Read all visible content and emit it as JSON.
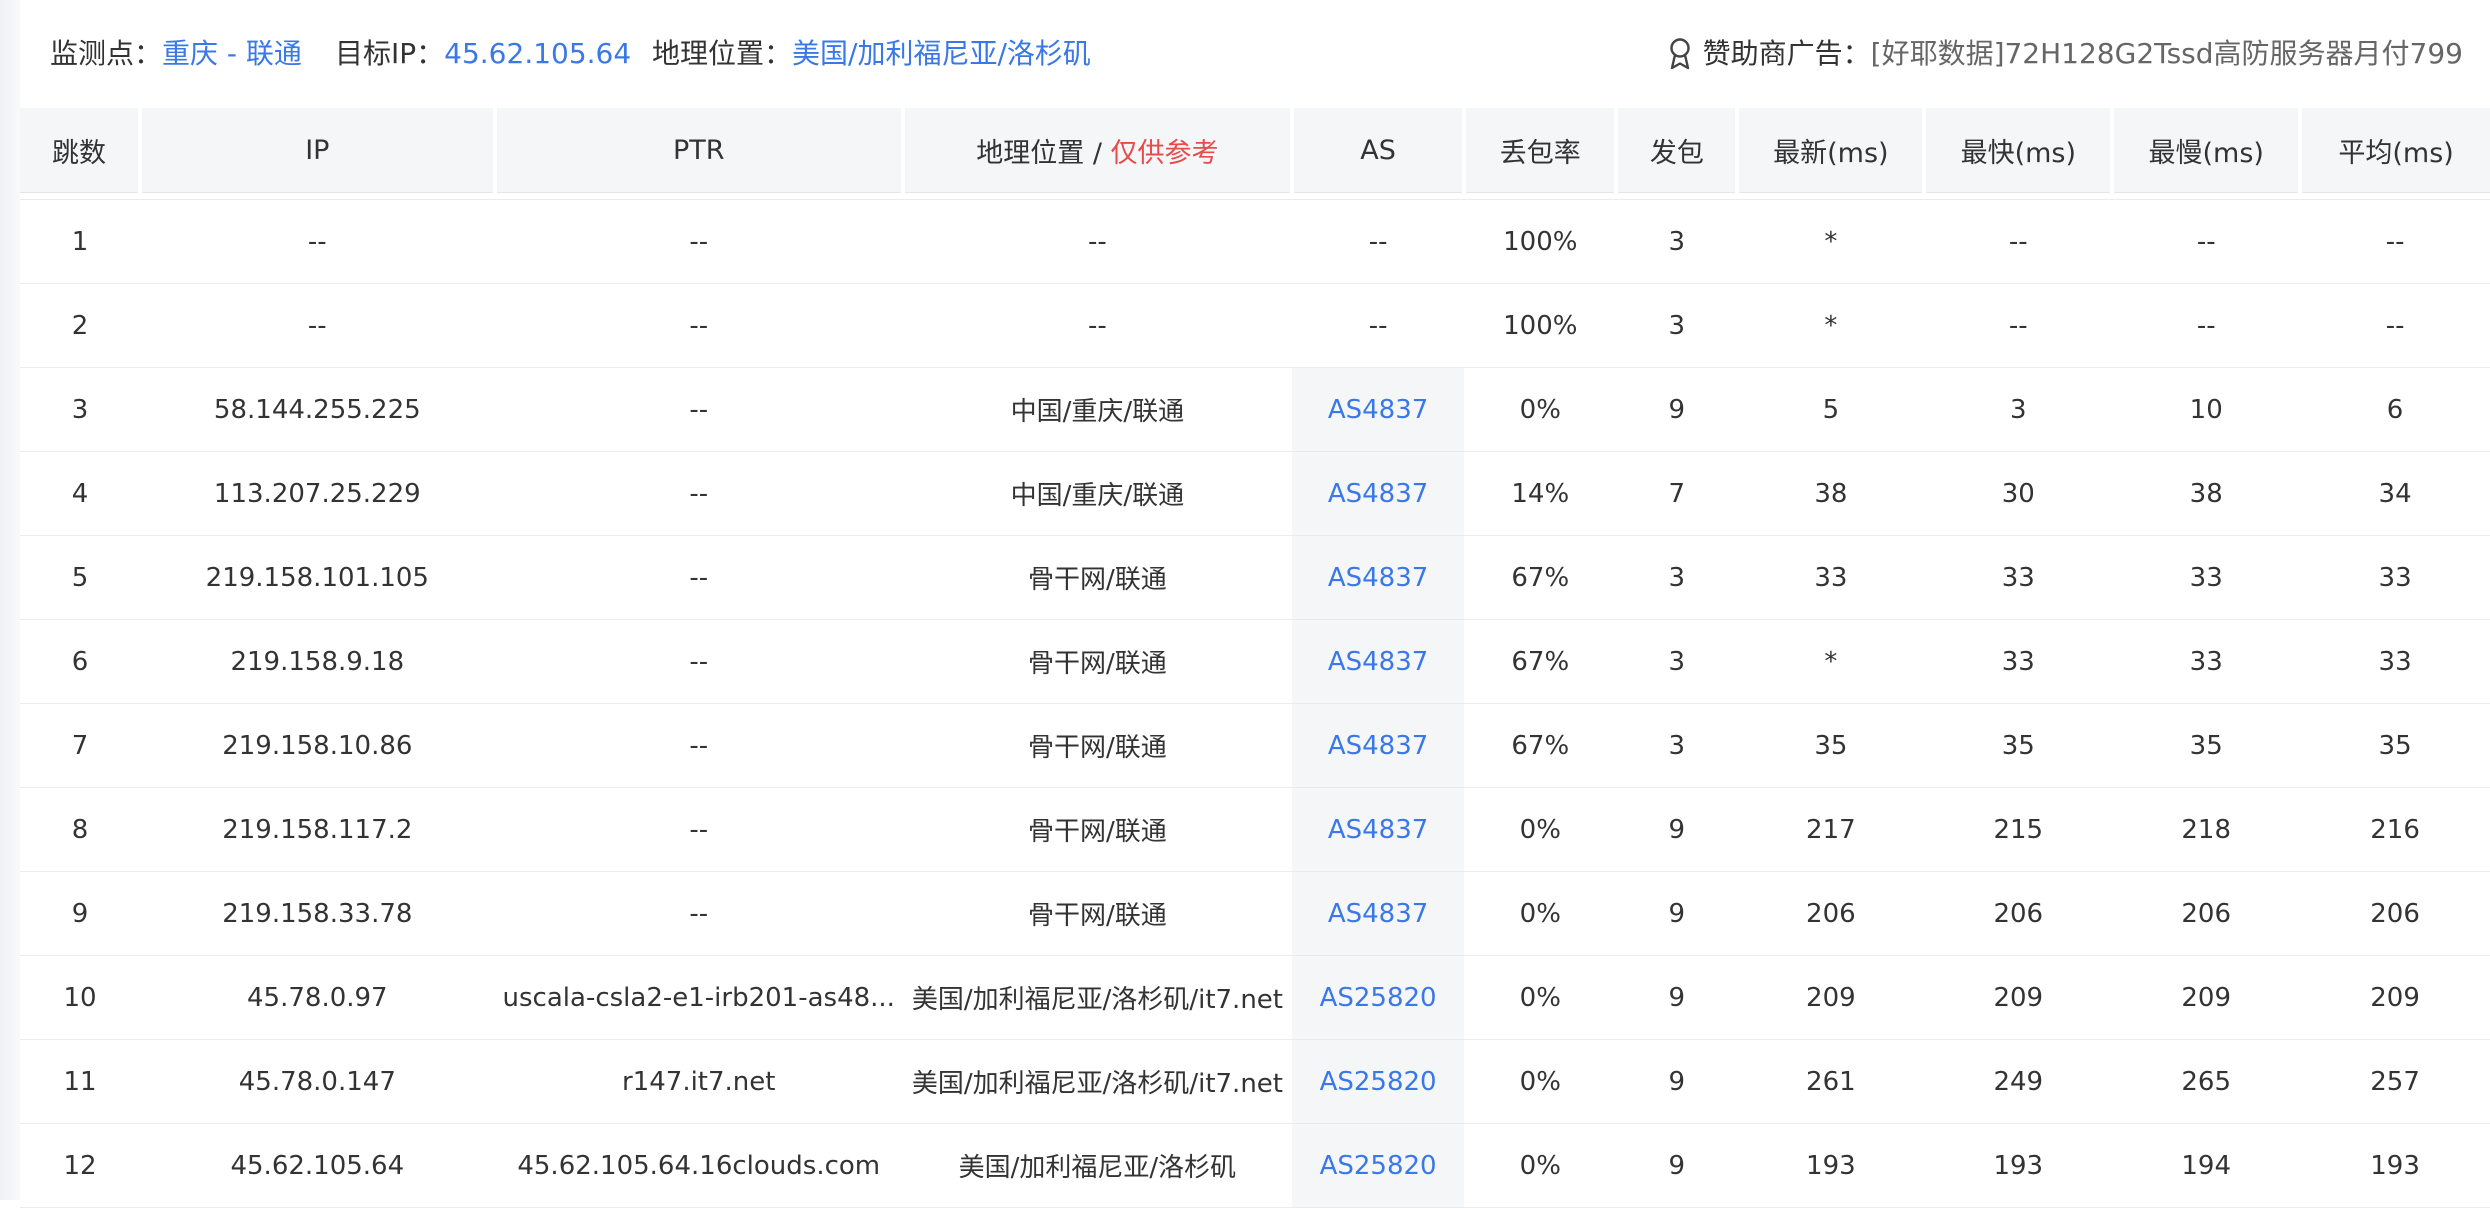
{
  "header": {
    "monitor_label": "监测点：",
    "monitor_value": "重庆 - 联通",
    "target_label": "目标IP：",
    "target_value": "45.62.105.64",
    "geo_label": "地理位置：",
    "geo_value": "美国/加利福尼亚/洛杉矶",
    "sponsor_icon": "award-icon",
    "sponsor_label": "赞助商广告：",
    "sponsor_value": "[好耶数据]72H128G2Tssd高防服务器月付799"
  },
  "columns": {
    "hop": "跳数",
    "ip": "IP",
    "ptr": "PTR",
    "geo": "地理位置 / ",
    "geo_note": "仅供参考",
    "as": "AS",
    "loss": "丢包率",
    "sent": "发包",
    "last": "最新(ms)",
    "best": "最快(ms)",
    "worst": "最慢(ms)",
    "avg": "平均(ms)"
  },
  "rows": [
    {
      "hop": "1",
      "ip": "--",
      "ptr": "--",
      "geo": "--",
      "as": "--",
      "loss": "100%",
      "sent": "3",
      "last": "*",
      "best": "--",
      "worst": "--",
      "avg": "--"
    },
    {
      "hop": "2",
      "ip": "--",
      "ptr": "--",
      "geo": "--",
      "as": "--",
      "loss": "100%",
      "sent": "3",
      "last": "*",
      "best": "--",
      "worst": "--",
      "avg": "--"
    },
    {
      "hop": "3",
      "ip": "58.144.255.225",
      "ptr": "--",
      "geo": "中国/重庆/联通",
      "as": "AS4837",
      "loss": "0%",
      "sent": "9",
      "last": "5",
      "best": "3",
      "worst": "10",
      "avg": "6"
    },
    {
      "hop": "4",
      "ip": "113.207.25.229",
      "ptr": "--",
      "geo": "中国/重庆/联通",
      "as": "AS4837",
      "loss": "14%",
      "sent": "7",
      "last": "38",
      "best": "30",
      "worst": "38",
      "avg": "34"
    },
    {
      "hop": "5",
      "ip": "219.158.101.105",
      "ptr": "--",
      "geo": "骨干网/联通",
      "as": "AS4837",
      "loss": "67%",
      "sent": "3",
      "last": "33",
      "best": "33",
      "worst": "33",
      "avg": "33"
    },
    {
      "hop": "6",
      "ip": "219.158.9.18",
      "ptr": "--",
      "geo": "骨干网/联通",
      "as": "AS4837",
      "loss": "67%",
      "sent": "3",
      "last": "*",
      "best": "33",
      "worst": "33",
      "avg": "33"
    },
    {
      "hop": "7",
      "ip": "219.158.10.86",
      "ptr": "--",
      "geo": "骨干网/联通",
      "as": "AS4837",
      "loss": "67%",
      "sent": "3",
      "last": "35",
      "best": "35",
      "worst": "35",
      "avg": "35"
    },
    {
      "hop": "8",
      "ip": "219.158.117.2",
      "ptr": "--",
      "geo": "骨干网/联通",
      "as": "AS4837",
      "loss": "0%",
      "sent": "9",
      "last": "217",
      "best": "215",
      "worst": "218",
      "avg": "216"
    },
    {
      "hop": "9",
      "ip": "219.158.33.78",
      "ptr": "--",
      "geo": "骨干网/联通",
      "as": "AS4837",
      "loss": "0%",
      "sent": "9",
      "last": "206",
      "best": "206",
      "worst": "206",
      "avg": "206"
    },
    {
      "hop": "10",
      "ip": "45.78.0.97",
      "ptr": "uscala-csla2-e1-irb201-as48...",
      "geo": "美国/加利福尼亚/洛杉矶/it7.net",
      "as": "AS25820",
      "loss": "0%",
      "sent": "9",
      "last": "209",
      "best": "209",
      "worst": "209",
      "avg": "209"
    },
    {
      "hop": "11",
      "ip": "45.78.0.147",
      "ptr": "r147.it7.net",
      "geo": "美国/加利福尼亚/洛杉矶/it7.net",
      "as": "AS25820",
      "loss": "0%",
      "sent": "9",
      "last": "261",
      "best": "249",
      "worst": "265",
      "avg": "257"
    },
    {
      "hop": "12",
      "ip": "45.62.105.64",
      "ptr": "45.62.105.64.16clouds.com",
      "geo": "美国/加利福尼亚/洛杉矶",
      "as": "AS25820",
      "loss": "0%",
      "sent": "9",
      "last": "193",
      "best": "193",
      "worst": "194",
      "avg": "193"
    }
  ]
}
